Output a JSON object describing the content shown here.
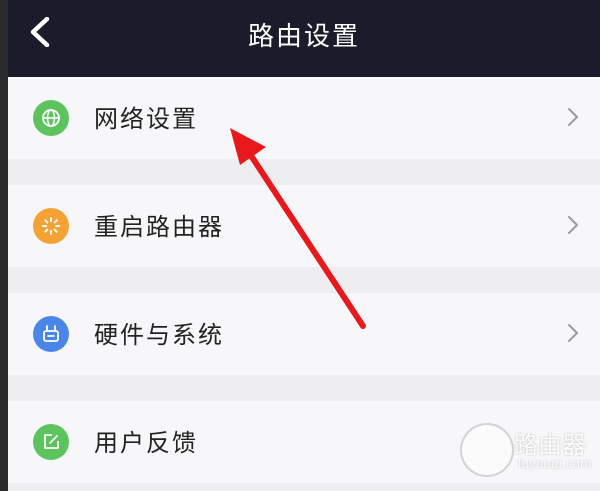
{
  "header": {
    "title": "路由设置",
    "back_icon": "chevron-left-icon"
  },
  "menu": [
    {
      "label": "网络设置",
      "icon": "globe-icon",
      "icon_color": "#5cc35d"
    },
    {
      "label": "重启路由器",
      "icon": "loading-spinner-icon",
      "icon_color": "#f4a234"
    },
    {
      "label": "硬件与系统",
      "icon": "router-icon",
      "icon_color": "#4a86e8"
    },
    {
      "label": "用户反馈",
      "icon": "edit-icon",
      "icon_color": "#5cc35d"
    }
  ],
  "annotation": {
    "arrow_color": "#e8191c",
    "target": "网络设置"
  },
  "watermark": {
    "title": "路由器",
    "subtitle": "luyouqi.com"
  }
}
